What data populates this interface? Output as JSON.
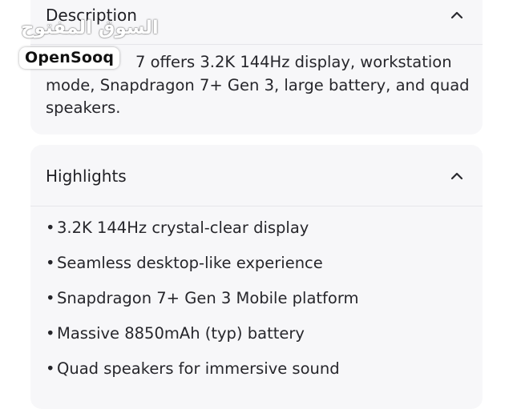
{
  "description": {
    "title": "Description",
    "text": "7 offers 3.2K 144Hz display, workstation mode, Snapdragon 7+ Gen 3, large battery, and quad speakers.",
    "expanded": true,
    "toggle_icon": "chevron-up-icon"
  },
  "highlights": {
    "title": "Highlights",
    "expanded": true,
    "toggle_icon": "chevron-up-icon",
    "items": [
      "3.2K 144Hz crystal-clear display",
      "Seamless desktop-like experience",
      "Snapdragon 7+ Gen 3 Mobile platform",
      "Massive 8850mAh (typ) battery",
      "Quad speakers for immersive sound"
    ]
  },
  "watermark": {
    "arabic": "السوق المفتوح",
    "logo": "OpenSooq"
  },
  "colors": {
    "card_background": "#f7f7f9",
    "text": "#26262b",
    "divider": "#e6e6ea"
  }
}
